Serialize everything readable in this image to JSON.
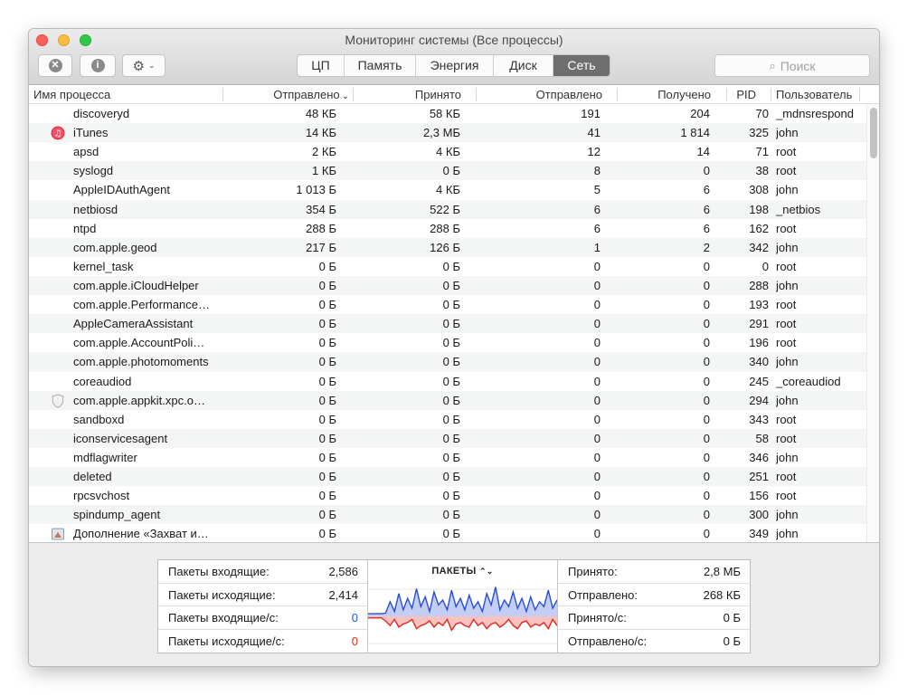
{
  "window": {
    "title": "Мониторинг системы (Все процессы)"
  },
  "toolbar": {
    "stop_icon": "x-circle-icon",
    "info_icon": "info-icon",
    "info_glyph": "i",
    "stop_glyph": "✕",
    "gear_glyph": "⚙",
    "caret_glyph": "⌄",
    "tabs": [
      "ЦП",
      "Память",
      "Энергия",
      "Диск",
      "Сеть"
    ],
    "active_tab": "Сеть",
    "search_placeholder": "Поиск",
    "search_glyph": "⌕"
  },
  "table": {
    "headers": {
      "name": "Имя процесса",
      "sent_bytes": "Отправлено",
      "sort_indicator": "⌄",
      "recv_bytes": "Принято",
      "sent_packets": "Отправлено",
      "recv_packets": "Получено",
      "pid": "PID",
      "user": "Пользователь"
    },
    "rows": [
      {
        "name": "discoveryd",
        "sent": "48 КБ",
        "recv": "58 КБ",
        "pout": "191",
        "pin": "204",
        "pid": "70",
        "user": "_mdnsrespond",
        "icon": ""
      },
      {
        "name": "iTunes",
        "sent": "14 КБ",
        "recv": "2,3 МБ",
        "pout": "41",
        "pin": "1 814",
        "pid": "325",
        "user": "john",
        "icon": "itunes-icon"
      },
      {
        "name": "apsd",
        "sent": "2 КБ",
        "recv": "4 КБ",
        "pout": "12",
        "pin": "14",
        "pid": "71",
        "user": "root",
        "icon": ""
      },
      {
        "name": "syslogd",
        "sent": "1 КБ",
        "recv": "0 Б",
        "pout": "8",
        "pin": "0",
        "pid": "38",
        "user": "root",
        "icon": ""
      },
      {
        "name": "AppleIDAuthAgent",
        "sent": "1 013 Б",
        "recv": "4 КБ",
        "pout": "5",
        "pin": "6",
        "pid": "308",
        "user": "john",
        "icon": ""
      },
      {
        "name": "netbiosd",
        "sent": "354 Б",
        "recv": "522 Б",
        "pout": "6",
        "pin": "6",
        "pid": "198",
        "user": "_netbios",
        "icon": ""
      },
      {
        "name": "ntpd",
        "sent": "288 Б",
        "recv": "288 Б",
        "pout": "6",
        "pin": "6",
        "pid": "162",
        "user": "root",
        "icon": ""
      },
      {
        "name": "com.apple.geod",
        "sent": "217 Б",
        "recv": "126 Б",
        "pout": "1",
        "pin": "2",
        "pid": "342",
        "user": "john",
        "icon": ""
      },
      {
        "name": "kernel_task",
        "sent": "0 Б",
        "recv": "0 Б",
        "pout": "0",
        "pin": "0",
        "pid": "0",
        "user": "root",
        "icon": ""
      },
      {
        "name": "com.apple.iCloudHelper",
        "sent": "0 Б",
        "recv": "0 Б",
        "pout": "0",
        "pin": "0",
        "pid": "288",
        "user": "john",
        "icon": ""
      },
      {
        "name": "com.apple.Performance…",
        "sent": "0 Б",
        "recv": "0 Б",
        "pout": "0",
        "pin": "0",
        "pid": "193",
        "user": "root",
        "icon": ""
      },
      {
        "name": "AppleCameraAssistant",
        "sent": "0 Б",
        "recv": "0 Б",
        "pout": "0",
        "pin": "0",
        "pid": "291",
        "user": "root",
        "icon": ""
      },
      {
        "name": "com.apple.AccountPoli…",
        "sent": "0 Б",
        "recv": "0 Б",
        "pout": "0",
        "pin": "0",
        "pid": "196",
        "user": "root",
        "icon": ""
      },
      {
        "name": "com.apple.photomoments",
        "sent": "0 Б",
        "recv": "0 Б",
        "pout": "0",
        "pin": "0",
        "pid": "340",
        "user": "john",
        "icon": ""
      },
      {
        "name": "coreaudiod",
        "sent": "0 Б",
        "recv": "0 Б",
        "pout": "0",
        "pin": "0",
        "pid": "245",
        "user": "_coreaudiod",
        "icon": ""
      },
      {
        "name": "com.apple.appkit.xpc.o…",
        "sent": "0 Б",
        "recv": "0 Б",
        "pout": "0",
        "pin": "0",
        "pid": "294",
        "user": "john",
        "icon": "shield-icon"
      },
      {
        "name": "sandboxd",
        "sent": "0 Б",
        "recv": "0 Б",
        "pout": "0",
        "pin": "0",
        "pid": "343",
        "user": "root",
        "icon": ""
      },
      {
        "name": "iconservicesagent",
        "sent": "0 Б",
        "recv": "0 Б",
        "pout": "0",
        "pin": "0",
        "pid": "58",
        "user": "root",
        "icon": ""
      },
      {
        "name": "mdflagwriter",
        "sent": "0 Б",
        "recv": "0 Б",
        "pout": "0",
        "pin": "0",
        "pid": "346",
        "user": "john",
        "icon": ""
      },
      {
        "name": "deleted",
        "sent": "0 Б",
        "recv": "0 Б",
        "pout": "0",
        "pin": "0",
        "pid": "251",
        "user": "root",
        "icon": ""
      },
      {
        "name": "rpcsvchost",
        "sent": "0 Б",
        "recv": "0 Б",
        "pout": "0",
        "pin": "0",
        "pid": "156",
        "user": "root",
        "icon": ""
      },
      {
        "name": "spindump_agent",
        "sent": "0 Б",
        "recv": "0 Б",
        "pout": "0",
        "pin": "0",
        "pid": "300",
        "user": "john",
        "icon": ""
      },
      {
        "name": "Дополнение «Захват и…",
        "sent": "0 Б",
        "recv": "0 Б",
        "pout": "0",
        "pin": "0",
        "pid": "349",
        "user": "john",
        "icon": "screenshot-extension-icon"
      }
    ]
  },
  "summary": {
    "left": [
      {
        "label": "Пакеты входящие:",
        "value": "2,586",
        "color": ""
      },
      {
        "label": "Пакеты исходящие:",
        "value": "2,414",
        "color": ""
      },
      {
        "label": "Пакеты входящие/с:",
        "value": "0",
        "color": "blue"
      },
      {
        "label": "Пакеты исходящие/с:",
        "value": "0",
        "color": "red"
      }
    ],
    "graph": {
      "title": "ПАКЕТЫ",
      "selector_glyph": "⌃⌄",
      "in_color": "#2a4fd6",
      "out_color": "#e0281c",
      "in_levels": [
        0.08,
        0.08,
        0.08,
        0.08,
        0.1,
        0.45,
        0.15,
        0.7,
        0.2,
        0.55,
        0.25,
        0.85,
        0.3,
        0.6,
        0.15,
        0.75,
        0.35,
        0.5,
        0.2,
        0.8,
        0.3,
        0.55,
        0.2,
        0.65,
        0.25,
        0.45,
        0.15,
        0.7,
        0.35,
        0.9,
        0.2,
        0.5,
        0.3,
        0.75,
        0.25,
        0.55,
        0.15,
        0.6,
        0.2,
        0.45,
        0.3,
        0.8,
        0.25,
        0.5
      ],
      "out_levels": [
        0.05,
        0.05,
        0.05,
        0.05,
        0.15,
        0.3,
        0.1,
        0.35,
        0.25,
        0.2,
        0.1,
        0.4,
        0.3,
        0.25,
        0.15,
        0.35,
        0.2,
        0.3,
        0.1,
        0.45,
        0.25,
        0.2,
        0.3,
        0.35,
        0.1,
        0.3,
        0.2,
        0.4,
        0.25,
        0.2,
        0.35,
        0.25,
        0.1,
        0.3,
        0.4,
        0.2,
        0.15,
        0.35,
        0.25,
        0.3,
        0.2,
        0.4,
        0.1,
        0.3
      ]
    },
    "right": [
      {
        "label": "Принято:",
        "value": "2,8 МБ"
      },
      {
        "label": "Отправлено:",
        "value": "268 КБ"
      },
      {
        "label": "Принято/с:",
        "value": "0 Б"
      },
      {
        "label": "Отправлено/с:",
        "value": "0 Б"
      }
    ]
  }
}
